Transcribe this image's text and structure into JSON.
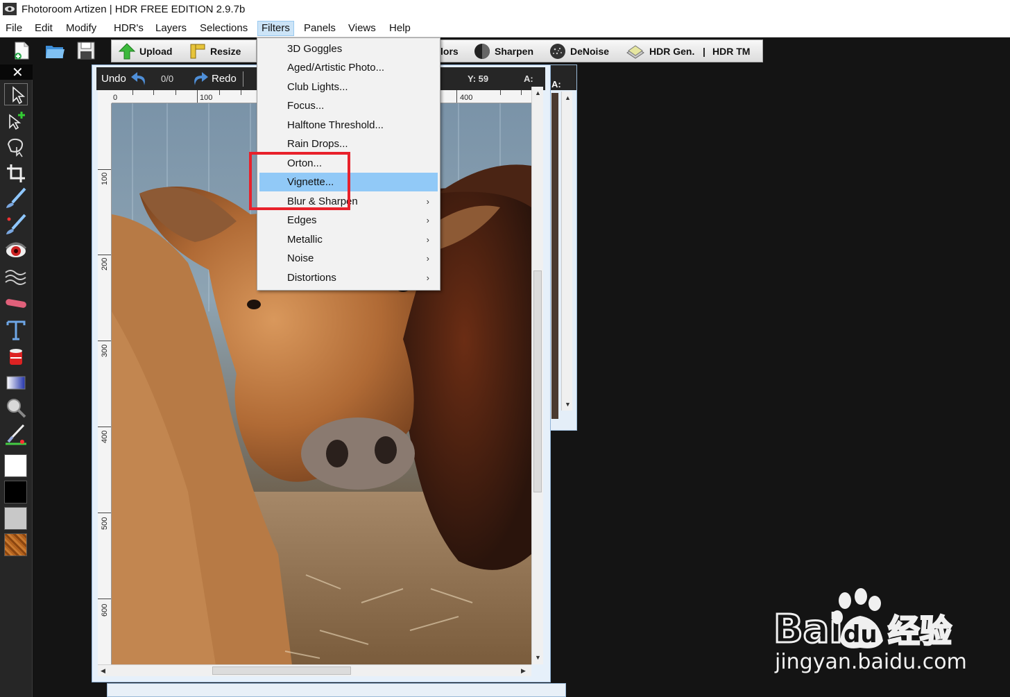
{
  "window": {
    "title": "Fhotoroom Artizen | HDR FREE EDITION 2.9.7b"
  },
  "menubar": {
    "items": [
      "File",
      "Edit",
      "Modify",
      "HDR's",
      "Layers",
      "Selections",
      "Filters",
      "Panels",
      "Views",
      "Help"
    ],
    "active": "Filters"
  },
  "toolbar": {
    "upload_label": "Upload",
    "resize_label": "Resize",
    "colors_label": "lors",
    "sharpen_label": "Sharpen",
    "denoise_label": "DeNoise",
    "hdrgen_label": "HDR Gen.",
    "separator": "|",
    "hdrtm_label": "HDR TM"
  },
  "toolpanel": {
    "close_label": "✕"
  },
  "document": {
    "undo_label": "Undo",
    "history_count": "0/0",
    "redo_label": "Redo",
    "y_readout": "Y: 59",
    "a_label": "A:",
    "ruler_h": [
      "0",
      "100",
      "400"
    ],
    "ruler_v": [
      "100",
      "200",
      "300",
      "400",
      "500",
      "600"
    ]
  },
  "background_doc": {
    "a_label": "A:"
  },
  "filters_menu": {
    "items": [
      {
        "label": "3D Goggles",
        "submenu": false
      },
      {
        "label": "Aged/Artistic Photo...",
        "submenu": false
      },
      {
        "label": "Club Lights...",
        "submenu": false
      },
      {
        "label": "Focus...",
        "submenu": false
      },
      {
        "label": "Halftone Threshold...",
        "submenu": false
      },
      {
        "label": "Rain Drops...",
        "submenu": false
      },
      {
        "label": "Orton...",
        "submenu": false
      },
      {
        "label": "Vignette...",
        "submenu": false,
        "highlighted": true
      },
      {
        "label": "Blur & Sharpen",
        "submenu": true
      },
      {
        "label": "Edges",
        "submenu": true
      },
      {
        "label": "Metallic",
        "submenu": true
      },
      {
        "label": "Noise",
        "submenu": true
      },
      {
        "label": "Distortions",
        "submenu": true
      }
    ],
    "submenu_arrow": "›"
  },
  "watermark": {
    "brand": "Bai",
    "brand2": "du",
    "chinese": "经验",
    "url": "jingyan.baidu.com"
  },
  "colors": {
    "highlight_box": "#e8212b",
    "menu_highlight": "#91c9f7",
    "menu_open": "#cce4f7"
  }
}
